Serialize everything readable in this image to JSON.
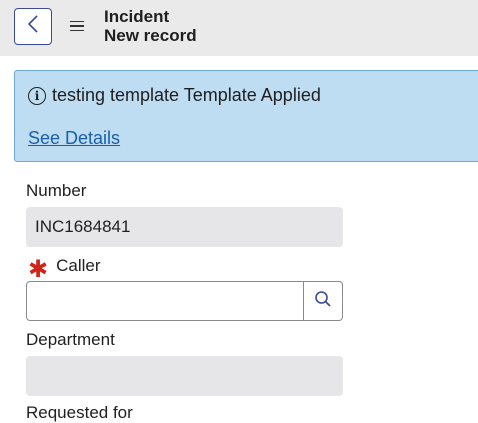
{
  "header": {
    "title": "Incident",
    "subtitle": "New record"
  },
  "banner": {
    "message": "testing template Template Applied",
    "link_label": "See Details",
    "background_color": "#bedcf2",
    "border_color": "#6ea6d5",
    "link_color": "#1a5fa8"
  },
  "form": {
    "number": {
      "label": "Number",
      "value": "INC1684841"
    },
    "caller": {
      "label": "Caller",
      "value": "",
      "required_symbol": "✱"
    },
    "department": {
      "label": "Department",
      "value": ""
    },
    "requested_for": {
      "label": "Requested for"
    }
  },
  "colors": {
    "required": "#d0241a",
    "header_bg": "#eaeaea"
  }
}
